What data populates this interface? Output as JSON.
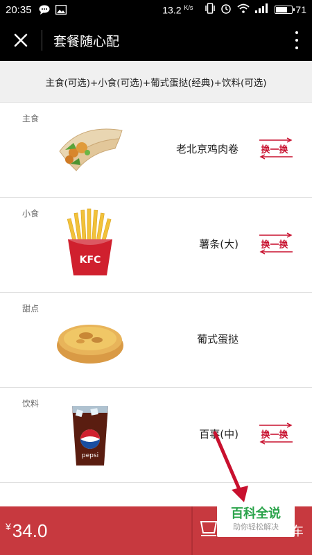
{
  "status_bar": {
    "time": "20:35",
    "speed": "13.2",
    "speed_unit": "K/s",
    "battery": "71"
  },
  "header": {
    "title": "套餐随心配"
  },
  "combo": {
    "description": "主食(可选)+小食(可选)+葡式蛋挞(经典)+饮料(可选)"
  },
  "items": [
    {
      "category": "主食",
      "name": "老北京鸡肉卷",
      "swap_label": "换一换",
      "image_icon": "chicken-wrap"
    },
    {
      "category": "小食",
      "name": "薯条(大)",
      "swap_label": "换一换",
      "image_icon": "french-fries"
    },
    {
      "category": "甜点",
      "name": "葡式蛋挞",
      "image_icon": "egg-tart"
    },
    {
      "category": "饮料",
      "name": "百事(中)",
      "swap_label": "换一换",
      "image_icon": "pepsi-cup"
    }
  ],
  "footer": {
    "currency": "¥",
    "price": "34.0",
    "cart_label": "车"
  },
  "watermark": {
    "title": "百科全说",
    "subtitle": "助你轻松解决"
  },
  "colors": {
    "accent": "#c7393f",
    "swap_red": "#c8102e",
    "watermark_green": "#2aa34a"
  }
}
